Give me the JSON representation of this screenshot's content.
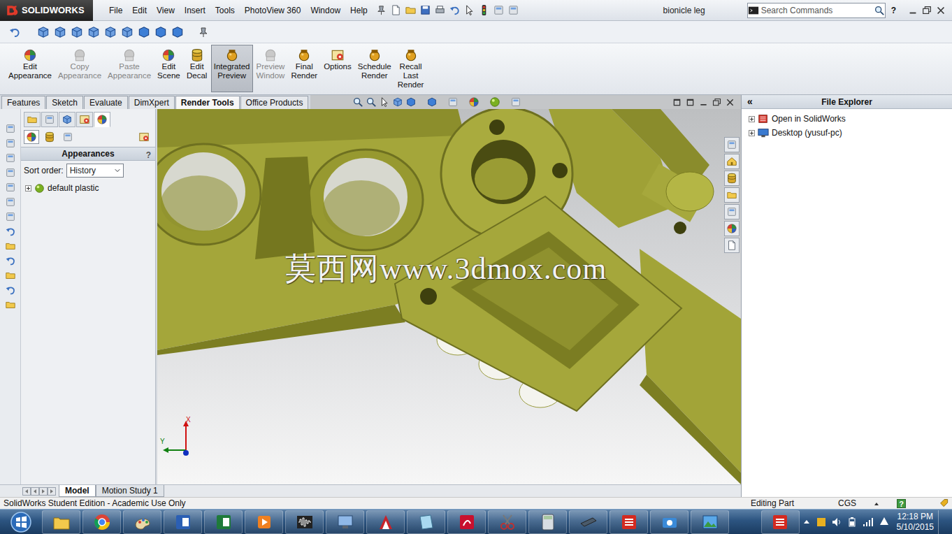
{
  "window": {
    "title": "bionicle leg",
    "logo": "SOLIDWORKS",
    "help": "?"
  },
  "menu": [
    {
      "label": "File"
    },
    {
      "label": "Edit"
    },
    {
      "label": "View"
    },
    {
      "label": "Insert"
    },
    {
      "label": "Tools"
    },
    {
      "label": "PhotoView 360"
    },
    {
      "label": "Window"
    },
    {
      "label": "Help"
    }
  ],
  "search": {
    "placeholder": "Search Commands"
  },
  "commands": [
    {
      "lines": [
        "Edit",
        "Appearance"
      ],
      "disabled": false,
      "selected": false
    },
    {
      "lines": [
        "Copy",
        "Appearance"
      ],
      "disabled": true,
      "selected": false
    },
    {
      "lines": [
        "Paste",
        "Appearance"
      ],
      "disabled": true,
      "selected": false
    },
    {
      "lines": [
        "Edit",
        "Scene"
      ],
      "disabled": false,
      "selected": false
    },
    {
      "lines": [
        "Edit",
        "Decal"
      ],
      "disabled": false,
      "selected": false
    },
    {
      "lines": [
        "Integrated",
        "Preview"
      ],
      "disabled": false,
      "selected": true
    },
    {
      "lines": [
        "Preview",
        "Window"
      ],
      "disabled": true,
      "selected": false
    },
    {
      "lines": [
        "Final",
        "Render"
      ],
      "disabled": false,
      "selected": false
    },
    {
      "lines": [
        "Options"
      ],
      "disabled": false,
      "selected": false
    },
    {
      "lines": [
        "Schedule",
        "Render"
      ],
      "disabled": false,
      "selected": false
    },
    {
      "lines": [
        "Recall",
        "Last",
        "Render"
      ],
      "disabled": false,
      "selected": false
    }
  ],
  "tabs": [
    {
      "label": "Features",
      "selected": false
    },
    {
      "label": "Sketch",
      "selected": false
    },
    {
      "label": "Evaluate",
      "selected": false
    },
    {
      "label": "DimXpert",
      "selected": false
    },
    {
      "label": "Render Tools",
      "selected": true
    },
    {
      "label": "Office Products",
      "selected": false
    }
  ],
  "panel": {
    "tabs": [
      {
        "selected": false
      },
      {
        "selected": false
      },
      {
        "selected": false
      },
      {
        "selected": false
      },
      {
        "selected": true
      }
    ],
    "subtabs": [
      {
        "selected": true
      },
      {
        "selected": false
      },
      {
        "selected": false
      }
    ],
    "title": "Appearances",
    "help": "?",
    "sort_label": "Sort order:",
    "sort_value": "History",
    "items": [
      {
        "label": "default plastic",
        "expanded": false
      }
    ]
  },
  "viewport": {
    "watermark": "莫西网www.3dmox.com",
    "triad": {
      "x": "X",
      "y": "Y"
    }
  },
  "file_explorer": {
    "collapse": "«",
    "title": "File Explorer",
    "items": [
      {
        "label": "Open in SolidWorks",
        "expanded": false
      },
      {
        "label": "Desktop (yusuf-pc)",
        "expanded": false
      }
    ]
  },
  "bottom_tabs": [
    {
      "label": "Model",
      "selected": true
    },
    {
      "label": "Motion Study 1",
      "selected": false
    }
  ],
  "status_bar": {
    "left": "SolidWorks Student Edition - Academic Use Only",
    "mode": "Editing Part",
    "units": "CGS",
    "help": "?"
  },
  "taskbar": {
    "time": "12:18 PM",
    "date": "5/10/2015"
  }
}
